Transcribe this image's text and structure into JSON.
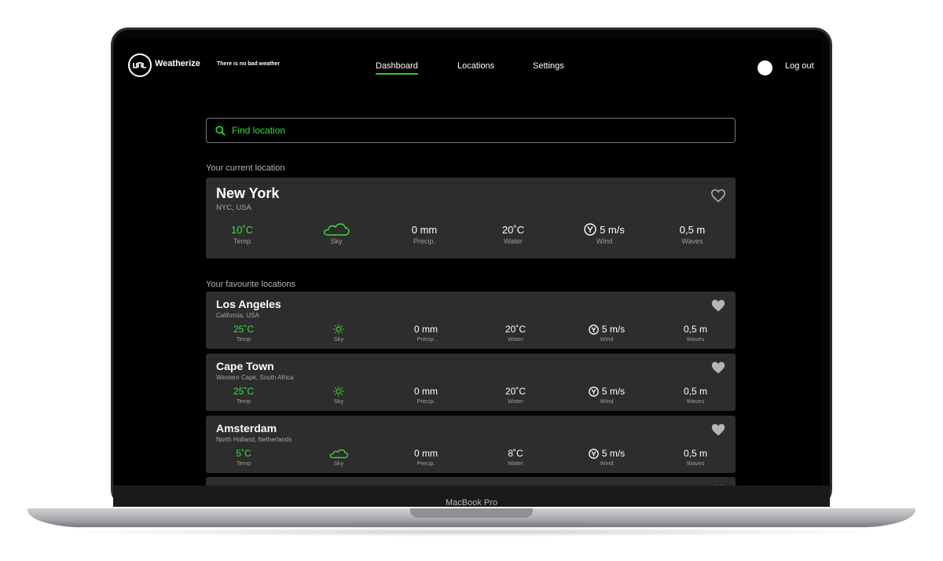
{
  "device": {
    "label": "MacBook Pro"
  },
  "header": {
    "brand": "Weatherize",
    "tagline": "There is no bad weather",
    "nav": [
      {
        "label": "Dashboard",
        "active": true
      },
      {
        "label": "Locations",
        "active": false
      },
      {
        "label": "Settings",
        "active": false
      }
    ],
    "logout": "Log out"
  },
  "search": {
    "placeholder": "Find location"
  },
  "sections": {
    "current": "Your current location",
    "favourites": "Your favourite locations"
  },
  "metric_labels": {
    "temp": "Temp",
    "sky": "Sky",
    "precip": "Precip.",
    "water": "Water",
    "wind": "Wind",
    "waves": "Waves"
  },
  "current": {
    "city": "New York",
    "region": "NYC, USA",
    "temp": "10˚C",
    "sky_icon": "cloud-icon",
    "precip": "0 mm",
    "water": "20˚C",
    "wind": "5 m/s",
    "waves": "0,5 m"
  },
  "favourites": [
    {
      "city": "Los Angeles",
      "region": "California, USA",
      "temp": "25˚C",
      "sky_icon": "sun-icon",
      "precip": "0 mm",
      "water": "20˚C",
      "wind": "5 m/s",
      "waves": "0,5 m"
    },
    {
      "city": "Cape Town",
      "region": "Western Cape, South Africa",
      "temp": "25˚C",
      "sky_icon": "sun-icon",
      "precip": "0 mm",
      "water": "20˚C",
      "wind": "5 m/s",
      "waves": "0,5 m"
    },
    {
      "city": "Amsterdam",
      "region": "North Holland, Netherlands",
      "temp": "5˚C",
      "sky_icon": "cloud-icon",
      "precip": "0 mm",
      "water": "8˚C",
      "wind": "5 m/s",
      "waves": "0,5 m"
    }
  ],
  "colors": {
    "accent": "#3ddc3d",
    "card": "#2d2d2d",
    "background": "#000000"
  }
}
